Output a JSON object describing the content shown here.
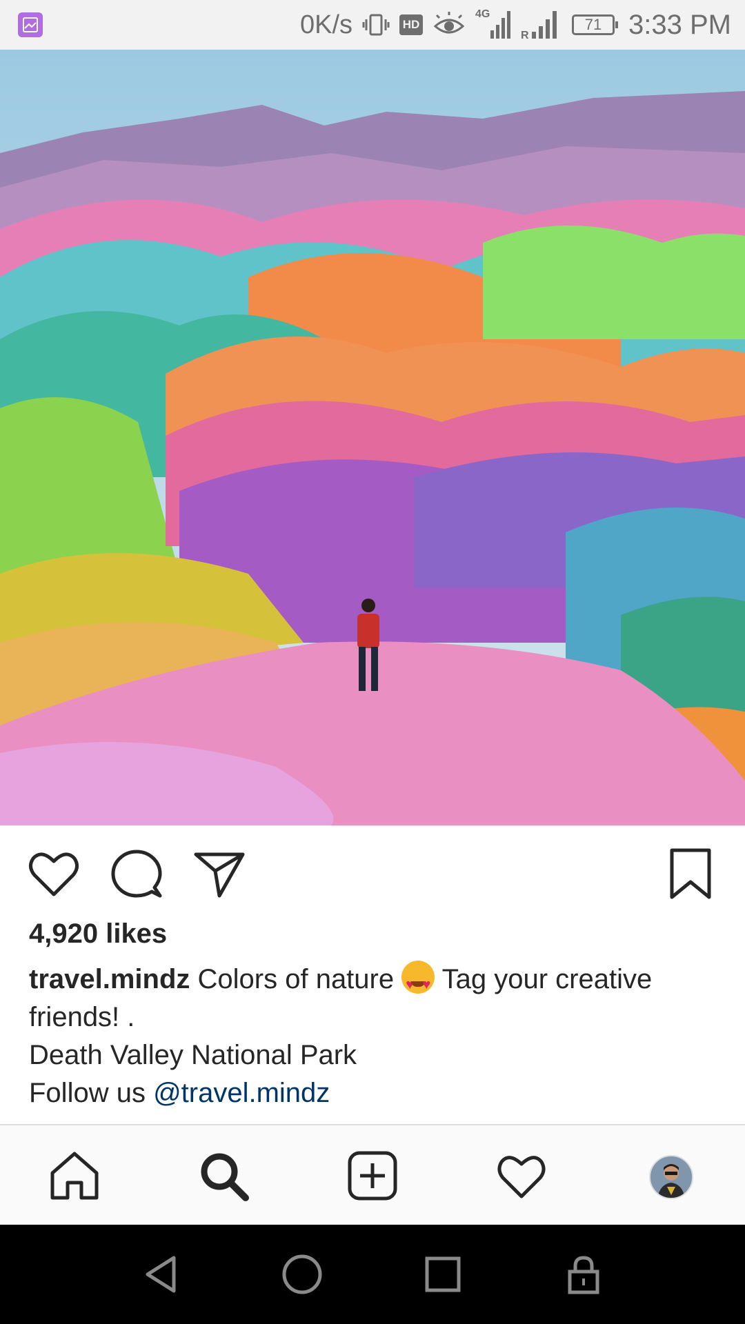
{
  "status_bar": {
    "net_speed": "0K/s",
    "hd_badge": "HD",
    "network_type": "4G",
    "battery": "71",
    "time": "3:33 PM",
    "icons": [
      "gallery-icon",
      "vibrate-icon",
      "eye-comfort-icon",
      "signal-icon",
      "battery-icon"
    ]
  },
  "post": {
    "image_alt": "Colorful rainbow mountains with a person standing",
    "likes": "4,920 likes",
    "username": "travel.mindz",
    "caption_part1": " Colors of nature ",
    "caption_part2": " Tag your creative friends! .",
    "caption_line2": "Death Valley National Park",
    "caption_line3_prefix": "Follow us ",
    "mention": "@travel.mindz"
  },
  "actions": {
    "icons": [
      "heart-icon",
      "comment-icon",
      "share-icon",
      "bookmark-icon"
    ]
  },
  "bottom_nav": {
    "items": [
      "home-icon",
      "search-icon",
      "add-post-icon",
      "activity-heart-icon",
      "profile-avatar"
    ]
  },
  "system_nav": {
    "items": [
      "back-icon",
      "home-circle-icon",
      "recents-icon",
      "lock-icon"
    ]
  },
  "colors": {
    "mention": "#003569",
    "text": "#262626",
    "status_bar_bg": "#f2f2f2",
    "nav_bg": "#fafafa"
  }
}
